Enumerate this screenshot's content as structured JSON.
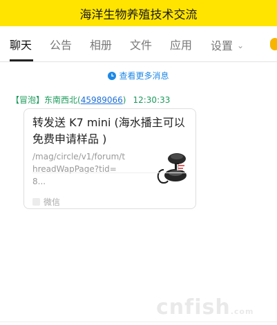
{
  "window": {
    "title": "海洋生物养殖技术交流"
  },
  "tabs": [
    {
      "label": "聊天"
    },
    {
      "label": "公告"
    },
    {
      "label": "相册"
    },
    {
      "label": "文件"
    },
    {
      "label": "应用"
    },
    {
      "label": "设置"
    }
  ],
  "chat": {
    "more_link": "查看更多消息",
    "message": {
      "role": "【冒泡】",
      "name": "东南西北",
      "uid": "45989066",
      "time": "12:30:33",
      "card": {
        "title": "转发送 K7 mini (海水播主可以免费申请样品 )",
        "desc": "/mag/circle/v1/forum/threadWapPage?tid=8...",
        "source": "微信"
      }
    }
  },
  "watermark": {
    "main": "cnfish",
    "suffix": ".com"
  },
  "colors": {
    "titlebar": "#ffe400",
    "link": "#1e88e5",
    "sender": "#1a9a5a"
  }
}
